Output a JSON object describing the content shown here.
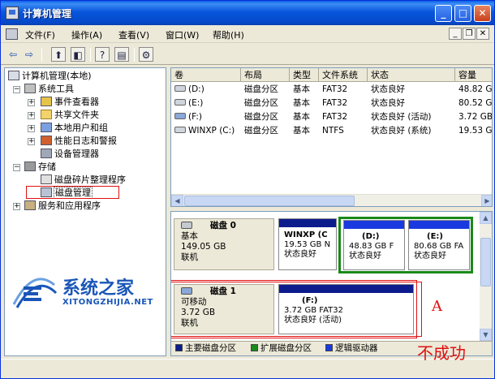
{
  "window": {
    "title": "计算机管理",
    "min_glyph": "_",
    "max_glyph": "□",
    "close_glyph": "✕"
  },
  "menubar": {
    "items": [
      "文件(F)",
      "操作(A)",
      "查看(V)",
      "窗口(W)",
      "帮助(H)"
    ],
    "mdi_min": "_",
    "mdi_restore": "❐",
    "mdi_close": "✕"
  },
  "toolbar": {
    "back_glyph": "⇦",
    "forward_glyph": "⇨",
    "up_glyph": "⬆",
    "showhide_glyph": "◧",
    "help_glyph": "?",
    "details_glyph": "▤",
    "props_glyph": "⚙"
  },
  "tree": {
    "root": "计算机管理(本地)",
    "system_tools": "系统工具",
    "event_viewer": "事件查看器",
    "shared_folders": "共享文件夹",
    "local_users": "本地用户和组",
    "perf_logs": "性能日志和警报",
    "device_manager": "设备管理器",
    "storage": "存储",
    "defrag": "磁盘碎片整理程序",
    "disk_mgmt": "磁盘管理",
    "services": "服务和应用程序",
    "expand": "+",
    "collapse": "−"
  },
  "volumes": {
    "columns": [
      "卷",
      "布局",
      "类型",
      "文件系统",
      "状态",
      "容量"
    ],
    "rows": [
      {
        "name": "(D:)",
        "layout": "磁盘分区",
        "type": "基本",
        "fs": "FAT32",
        "status": "状态良好",
        "capacity": "48.82 GB"
      },
      {
        "name": "(E:)",
        "layout": "磁盘分区",
        "type": "基本",
        "fs": "FAT32",
        "status": "状态良好",
        "capacity": "80.52 GB"
      },
      {
        "name": "(F:)",
        "layout": "磁盘分区",
        "type": "基本",
        "fs": "FAT32",
        "status": "状态良好 (活动)",
        "capacity": "3.72 GB"
      },
      {
        "name": "WINXP (C:)",
        "layout": "磁盘分区",
        "type": "基本",
        "fs": "NTFS",
        "status": "状态良好 (系统)",
        "capacity": "19.53 GB"
      }
    ]
  },
  "disks": {
    "disk0": {
      "name": "磁盘 0",
      "type": "基本",
      "size": "149.05 GB",
      "state": "联机",
      "partitions": [
        {
          "name": "WINXP  (C",
          "size": "19.53 GB N",
          "status": "状态良好"
        },
        {
          "name": "(D:)",
          "size": "48.83 GB F",
          "status": "状态良好"
        },
        {
          "name": "(E:)",
          "size": "80.68 GB FA",
          "status": "状态良好"
        }
      ]
    },
    "disk1": {
      "name": "磁盘 1",
      "type": "可移动",
      "size": "3.72 GB",
      "state": "联机",
      "partition": {
        "name": "(F:)",
        "size": "3.72 GB FAT32",
        "status": "状态良好 (活动)"
      }
    }
  },
  "legend": {
    "primary": "主要磁盘分区",
    "extended": "扩展磁盘分区",
    "logical": "逻辑驱动器"
  },
  "colors": {
    "primary": "#0c1c8c",
    "extended": "#1a8a1a",
    "logical": "#1a3ae0",
    "annotation": "#e01010"
  },
  "annotations": {
    "marker_a": "A",
    "fail_text": "不成功"
  },
  "watermark": {
    "cn": "系统之家",
    "en": "XITONGZHIJIA.NET"
  }
}
